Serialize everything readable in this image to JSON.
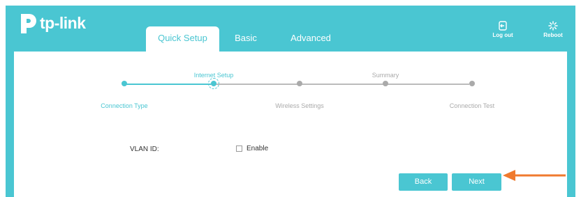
{
  "brand": {
    "name": "tp-link"
  },
  "tabs": [
    {
      "label": "Quick Setup",
      "active": true
    },
    {
      "label": "Basic",
      "active": false
    },
    {
      "label": "Advanced",
      "active": false
    }
  ],
  "header_buttons": {
    "logout": {
      "label": "Log out",
      "icon": "logout-icon"
    },
    "reboot": {
      "label": "Reboot",
      "icon": "reboot-icon"
    }
  },
  "wizard": {
    "steps": [
      {
        "label": "Connection Type",
        "status": "done"
      },
      {
        "label": "Internet Setup",
        "status": "current"
      },
      {
        "label": "Wireless Settings",
        "status": "pending"
      },
      {
        "label": "Summary",
        "status": "pending"
      },
      {
        "label": "Connection Test",
        "status": "pending"
      }
    ]
  },
  "form": {
    "vlan_label": "VLAN ID:",
    "enable_label": "Enable",
    "enable_checked": false
  },
  "buttons": {
    "back": "Back",
    "next": "Next"
  },
  "colors": {
    "accent": "#4ac6d2",
    "arrow": "#f07a2e",
    "inactive": "#bbbbbb"
  }
}
